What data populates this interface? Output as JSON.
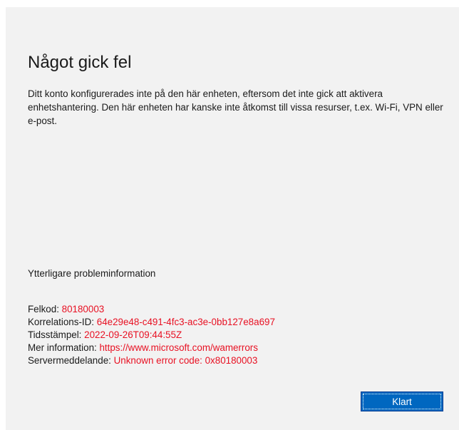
{
  "dialog": {
    "title": "Något gick fel",
    "message": "Ditt konto konfigurerades inte på den här enheten, eftersom det inte gick att aktivera enhetshantering. Den här enheten har kanske inte åtkomst till vissa resurser, t.ex. Wi-Fi, VPN eller e-post.",
    "more_heading": "Ytterligare probleminformation",
    "details": [
      {
        "label": "Felkod: ",
        "value": "80180003"
      },
      {
        "label": "Korrelations-ID: ",
        "value": "64e29e48-c491-4fc3-ac3e-0bb127e8a697"
      },
      {
        "label": "Tidsstämpel: ",
        "value": "2022-09-26T09:44:55Z"
      },
      {
        "label": "Mer information: ",
        "value": "https://www.microsoft.com/wamerrors"
      },
      {
        "label": "Servermeddelande: ",
        "value": "Unknown error code: 0x80180003"
      }
    ],
    "done_label": "Klart"
  },
  "colors": {
    "background": "#f2f2f2",
    "error_value": "#e81123",
    "accent": "#0067c0"
  }
}
